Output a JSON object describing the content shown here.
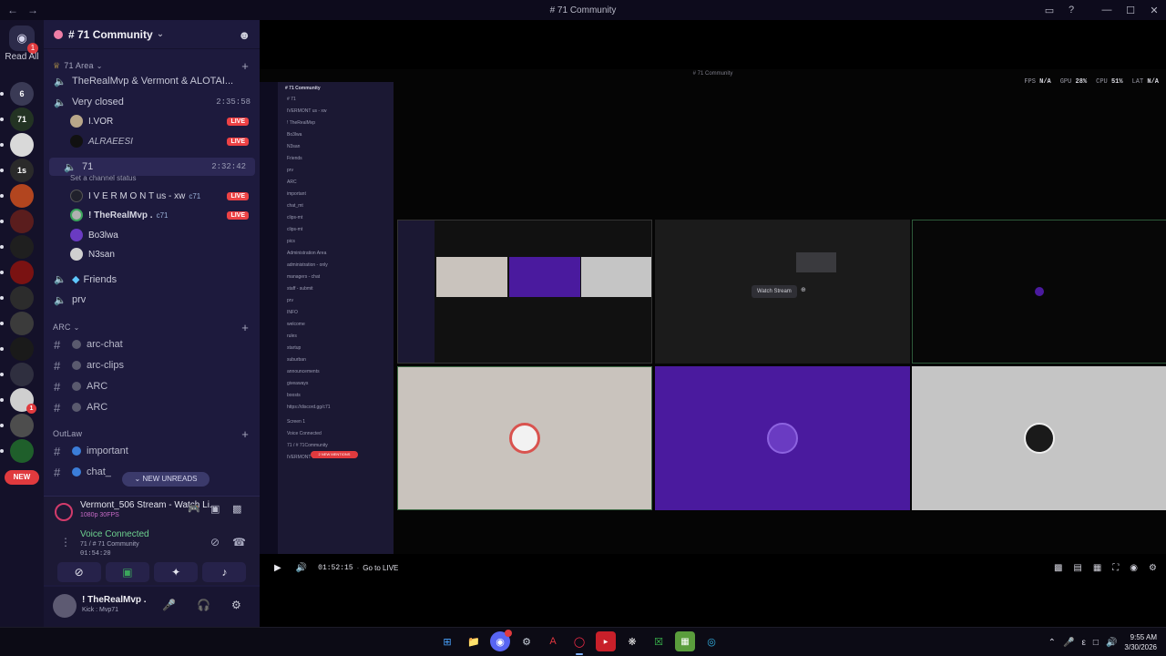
{
  "window": {
    "title": "# 71 Community",
    "back_glyph": "←",
    "forward_glyph": "→",
    "inbox_glyph": "▭",
    "help_glyph": "?",
    "minimize_glyph": "—",
    "maximize_glyph": "☐",
    "close_glyph": "✕"
  },
  "rail": {
    "home_badge": "1",
    "read_all": "Read All",
    "servers": [
      {
        "icon": "server-icon",
        "color": "#3a3a55",
        "text": "6",
        "badge": ""
      },
      {
        "icon": "server-icon",
        "color": "#233323",
        "text": "71",
        "badge": ""
      },
      {
        "icon": "server-icon",
        "color": "#d9d9d9",
        "text": "",
        "badge": ""
      },
      {
        "icon": "server-icon",
        "color": "#2a2a2a",
        "text": "1s",
        "badge": ""
      },
      {
        "icon": "server-icon",
        "color": "#b2451f",
        "text": "",
        "badge": ""
      },
      {
        "icon": "server-icon",
        "color": "#5a1d1d",
        "text": "",
        "badge": ""
      },
      {
        "icon": "server-icon",
        "color": "#1f1f1f",
        "text": "",
        "badge": ""
      },
      {
        "icon": "server-icon",
        "color": "#7a1212",
        "text": "",
        "badge": ""
      },
      {
        "icon": "server-icon",
        "color": "#2c2c2c",
        "text": "",
        "badge": ""
      },
      {
        "icon": "server-icon",
        "color": "#3b3b3b",
        "text": "",
        "badge": ""
      },
      {
        "icon": "server-icon",
        "color": "#1a1a1a",
        "text": "",
        "badge": ""
      },
      {
        "icon": "server-icon",
        "color": "#2f2f3f",
        "text": "",
        "badge": ""
      },
      {
        "icon": "server-icon",
        "color": "#cfcfcf",
        "text": "",
        "badge": "1"
      },
      {
        "icon": "server-icon",
        "color": "#4d4d4d",
        "text": "",
        "badge": ""
      },
      {
        "icon": "server-icon",
        "color": "#1f5f2b",
        "text": "",
        "badge": ""
      }
    ],
    "new_label": "NEW"
  },
  "sidebar": {
    "server_name": "# 71 Community",
    "category_71area": "71 Area",
    "channels": {
      "ch1": {
        "name": "TheRealMvp & Vermont & ALOTAI...",
        "time": ""
      },
      "very_closed": {
        "name": "Very closed",
        "time": "2:35:58"
      },
      "ch71": {
        "name": "71",
        "time": "2:32:42"
      },
      "friends": {
        "name": "Friends"
      },
      "prv": {
        "name": "prv"
      }
    },
    "very_closed_users": [
      {
        "name": "I.VOR",
        "live": "LIVE"
      },
      {
        "name": "ALRAEESI",
        "live": "LIVE"
      }
    ],
    "status_text": "Set a channel status",
    "ch71_users": [
      {
        "name": "I V E R M O N T us - xw",
        "tag": "c71",
        "live": "LIVE"
      },
      {
        "name": "! TheRealMvp .",
        "tag": "c71",
        "live": "LIVE"
      },
      {
        "name": "Bo3lwa",
        "tag": "",
        "live": ""
      },
      {
        "name": "N3san",
        "tag": "",
        "live": ""
      }
    ],
    "category_arc": "ARC",
    "arc_channels": [
      "arc-chat",
      "arc-clips",
      "ARC",
      "ARC"
    ],
    "category_outlaw": "OutLaw",
    "outlaw_channels": [
      "important",
      "chat_"
    ],
    "new_unreads": "NEW UNREADS",
    "stream": {
      "title": "Vermont_506 Stream - Watch Li...",
      "subtitle": "1080p 30FPS"
    },
    "voice": {
      "status": "Voice Connected",
      "location": "71 / # 71 Community",
      "elapsed": "01:54:20"
    },
    "user": {
      "name": "! TheRealMvp .",
      "status": "Kick : Mvp71"
    }
  },
  "stream_view": {
    "title": "# 71 Community",
    "stats": {
      "fps_label": "FPS",
      "fps_value": "N/A",
      "gpu_label": "GPU",
      "gpu_value": "28%",
      "cpu_label": "CPU",
      "cpu_value": "51%",
      "lat_label": "LAT",
      "lat_value": "N/A"
    },
    "mini": {
      "server_name": "# 71 Community",
      "lines": [
        "# 71",
        "IVERMONT us - xw",
        "! TheRealMvp",
        "Bo3lwa",
        "N3san",
        "Friends",
        "prv",
        "ARC",
        "important",
        "chat_mt",
        "clips-mt",
        "clips-mt",
        "pics",
        "Administration Area",
        "administration - only",
        "managers - chat",
        "staff - submit",
        "prv",
        "INFO",
        "welcome",
        "rules",
        "startup",
        "suburban",
        "announcements",
        "giveaways",
        "boosts",
        "https://discord.gg/c71",
        "Screen 1",
        "Voice Connected",
        "71 / # 71Community",
        "IVERMONT us - xw"
      ],
      "new_mentions": "2 NEW MENTIONS"
    },
    "watch_stream": "Watch Stream"
  },
  "player": {
    "time": "01:52:15",
    "go_live": "Go to LIVE"
  },
  "taskbar": {
    "time": "9:55 AM",
    "date": "3/30/2026",
    "lang": "ε"
  }
}
